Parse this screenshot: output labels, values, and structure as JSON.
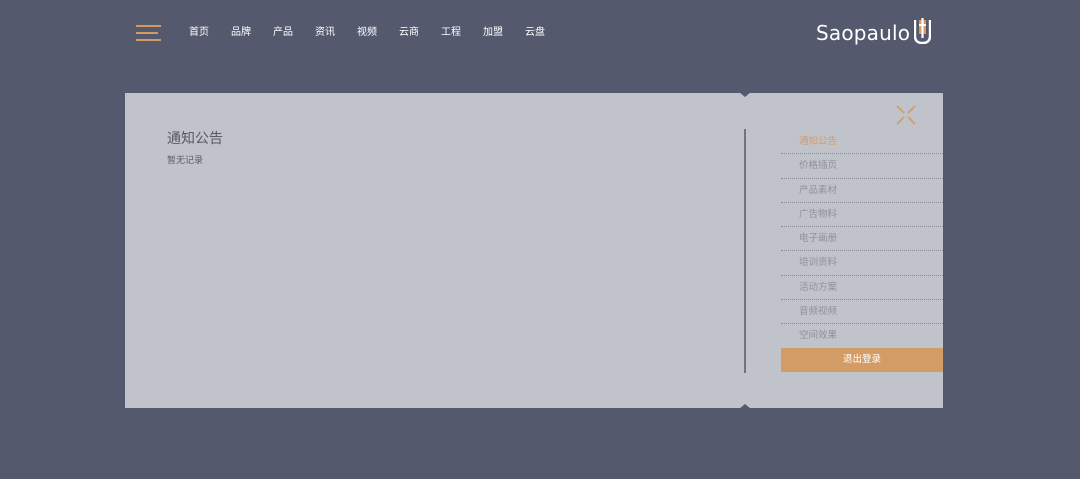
{
  "header": {
    "nav_items": [
      "首页",
      "品牌",
      "产品",
      "资讯",
      "视频",
      "云商",
      "工程",
      "加盟",
      "云盘"
    ],
    "logo_text": "Saopaulo"
  },
  "content": {
    "title": "通知公告",
    "empty_text": "暂无记录"
  },
  "side_menu": {
    "items": [
      "通知公告",
      "价格插页",
      "产品素材",
      "广告物料",
      "电子画册",
      "培训资料",
      "活动方案",
      "音频视频",
      "空间效果"
    ],
    "active_index": 0,
    "logout_label": "退出登录"
  },
  "colors": {
    "background": "#54596e",
    "panel": "#c1c3ca",
    "accent": "#d49a64",
    "logout_button": "#d39c66"
  },
  "icons": [
    "menu-icon",
    "close-icon",
    "logo-mark-icon"
  ]
}
